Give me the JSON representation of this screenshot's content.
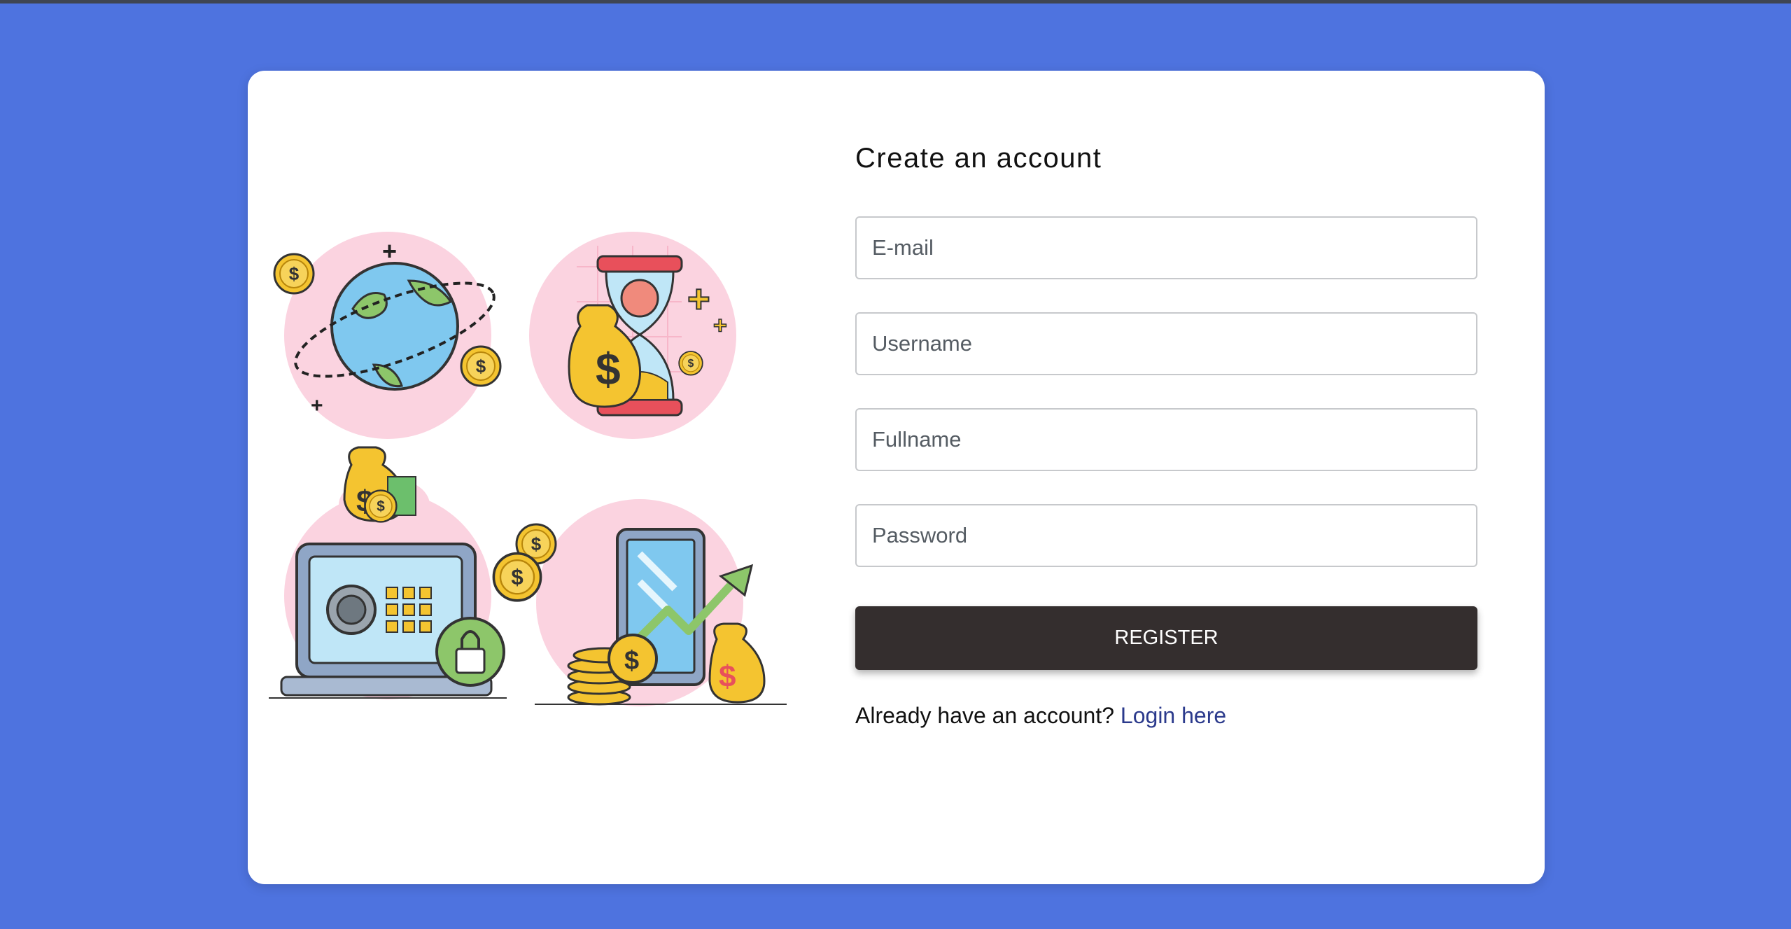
{
  "form": {
    "title": "Create an account",
    "fields": [
      {
        "placeholder": "E-mail",
        "value": ""
      },
      {
        "placeholder": "Username",
        "value": ""
      },
      {
        "placeholder": "Fullname",
        "value": ""
      },
      {
        "placeholder": "Password",
        "value": ""
      }
    ],
    "register_label": "REGISTER",
    "login_prompt": "Already have an account?",
    "login_link": "Login here"
  },
  "illustration": {
    "icons": [
      "globe-coins-icon",
      "hourglass-money-icon",
      "laptop-safe-icon",
      "phone-growth-icon"
    ]
  },
  "colors": {
    "background": "#4e73df",
    "card": "#ffffff",
    "button": "#342e2e",
    "link": "#2b3a8c",
    "accent_pink": "#fbd3e0",
    "coin": "#f4c430"
  }
}
